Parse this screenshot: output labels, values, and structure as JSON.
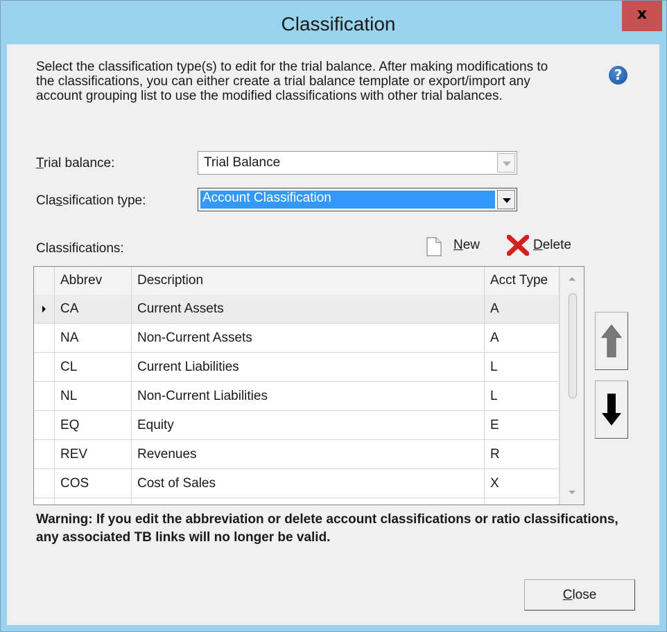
{
  "window": {
    "title": "Classification",
    "close_glyph": "x"
  },
  "intro_text": "Select the classification type(s) to edit for the trial balance.  After making modifications to the classifications, you can either create a trial balance template or export/import any account grouping list to use the modified classifications with other trial balances.",
  "help_icon": "question-mark-icon",
  "trial_balance": {
    "label_prefix": "",
    "label_mnemonic": "T",
    "label_rest": "rial balance:",
    "value": "Trial Balance"
  },
  "classification_type": {
    "label_prefix": "Cla",
    "label_mnemonic": "s",
    "label_rest": "sification type:",
    "value": "Account Classification"
  },
  "classifications_label": "Classifications:",
  "new_button": {
    "mnemonic": "N",
    "rest": "ew",
    "icon": "new-document-icon"
  },
  "delete_button": {
    "mnemonic": "D",
    "rest": "elete",
    "icon": "red-x-delete-icon"
  },
  "table": {
    "columns": [
      "Abbrev",
      "Description",
      "Acct Type"
    ],
    "rows": [
      {
        "abbrev": "CA",
        "description": "Current Assets",
        "type": "A"
      },
      {
        "abbrev": "NA",
        "description": "Non-Current Assets",
        "type": "A"
      },
      {
        "abbrev": "CL",
        "description": "Current Liabilities",
        "type": "L"
      },
      {
        "abbrev": "NL",
        "description": "Non-Current Liabilities",
        "type": "L"
      },
      {
        "abbrev": "EQ",
        "description": "Equity",
        "type": "E"
      },
      {
        "abbrev": "REV",
        "description": "Revenues",
        "type": "R"
      },
      {
        "abbrev": "COS",
        "description": "Cost of Sales",
        "type": "X"
      }
    ]
  },
  "move_up_icon": "arrow-up-icon",
  "move_down_icon": "arrow-down-icon",
  "warning_text": "Warning:  If you edit the abbreviation or delete account classifications or ratio classifications, any associated TB links will no longer be valid.",
  "close_button": {
    "mnemonic": "C",
    "rest": "lose"
  },
  "colors": {
    "title_bar": "#9ad3ee",
    "close_red": "#c75050",
    "selection_blue": "#3399ff",
    "dialog_bg": "#f0f0f0"
  }
}
